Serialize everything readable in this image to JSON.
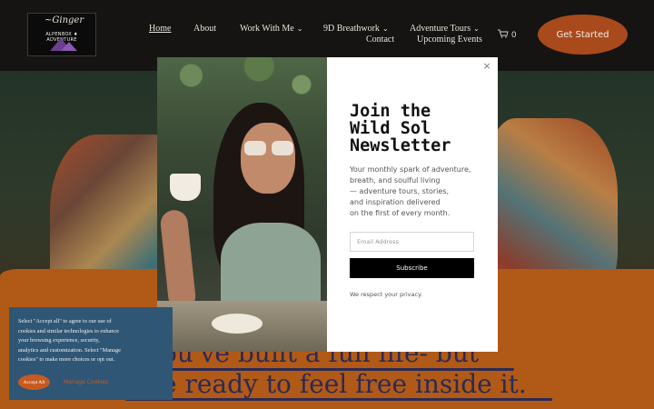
{
  "logo": {
    "script": "~Ginger",
    "brand": "ALPENBOX ♦ ADVENTURE"
  },
  "nav": {
    "home": "Home",
    "about": "About",
    "work_with_me": "Work With Me",
    "breathwork": "9D Breathwork",
    "adventure_tours": "Adventure Tours",
    "contact": "Contact",
    "upcoming_events": "Upcoming Events",
    "cart_count": "0",
    "get_started": "Get Started"
  },
  "hero": {
    "headline_line1": "ou've built a full life- but",
    "headline_line2": "e ready to feel free inside it."
  },
  "popup": {
    "title_lines": [
      "Join the",
      "Wild Sol",
      "Newsletter"
    ],
    "body_lines": [
      "Your monthly spark of adventure,",
      "breath, and soulful living",
      "— adventure tours, stories,",
      "and inspiration delivered",
      "on the first of every month."
    ],
    "email_placeholder": "Email Address",
    "subscribe_label": "Subscribe",
    "privacy_note": "We respect your privacy.",
    "close_glyph": "×"
  },
  "cookie_banner": {
    "lines": [
      "Select \"Accept all\" to agree to our use of",
      "cookies and similar technologies to enhance",
      "your browsing experience, security,",
      "analytics and customization. Select \"Manage",
      "cookies\" to make more choices or opt out."
    ],
    "accept_label": "Accept All",
    "manage_label": "Manage Cookies"
  },
  "colors": {
    "header_bg": "#151412",
    "cta": "#a94a1c",
    "ochre": "#b15a17",
    "headline": "#2b2a55",
    "cookie_bg": "#2f5675",
    "cookie_accent": "#c65a21"
  }
}
